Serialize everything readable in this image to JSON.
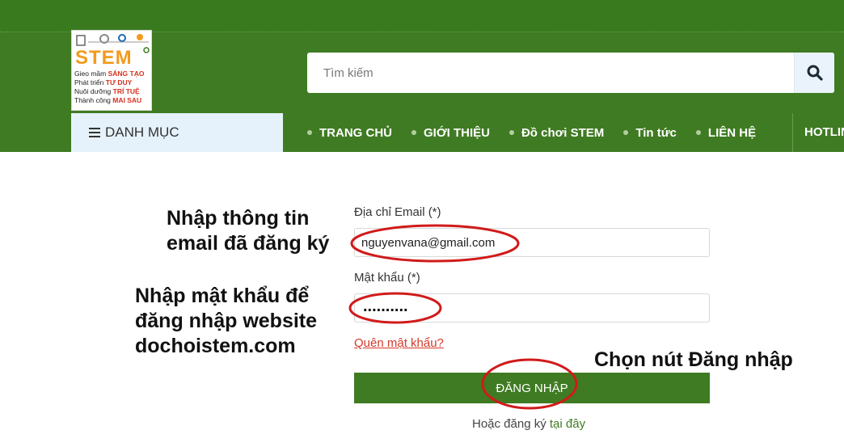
{
  "logo": {
    "wordmark": "STEM",
    "tagline_lines": [
      {
        "pre": "Gieo mầm ",
        "bold": "SÁNG TẠO"
      },
      {
        "pre": "Phát triển ",
        "bold": "TƯ DUY"
      },
      {
        "pre": "Nuôi dưỡng ",
        "bold": "TRÍ TUỆ"
      },
      {
        "pre": "Thành công ",
        "bold": "MAI SAU"
      }
    ]
  },
  "search": {
    "placeholder": "Tìm kiếm",
    "icon": "search-icon"
  },
  "category_menu": {
    "label": "DANH MỤC",
    "icon": "menu-icon"
  },
  "nav": {
    "items": [
      {
        "label": "TRANG CHỦ"
      },
      {
        "label": "GIỚI THIỆU"
      },
      {
        "label": "Đồ chơi STEM"
      },
      {
        "label": "Tin tức"
      },
      {
        "label": "LIÊN HỆ"
      }
    ],
    "hotline_label": "HOTLINE"
  },
  "login_form": {
    "email_label": "Địa chỉ Email (*)",
    "email_value": "nguyenvana@gmail.com",
    "password_label": "Mật khẩu (*)",
    "password_mask": "..........",
    "forgot_link": "Quên mật khẩu?",
    "submit_label": "ĐĂNG NHẬP",
    "register_prefix": "Hoặc đăng ký ",
    "register_link": "tại đây"
  },
  "annotations": {
    "email_note_line1": "Nhập thông tin",
    "email_note_line2": "email đã đăng ký",
    "password_note_line1": "Nhập mật khẩu để",
    "password_note_line2": "đăng nhập website",
    "password_note_line3": "dochoistem.com",
    "button_note": "Chọn nút Đăng nhập"
  },
  "colors": {
    "brand_green": "#3f7b22",
    "annotation_red": "#d11a1a",
    "link_red": "#d23a2a"
  }
}
